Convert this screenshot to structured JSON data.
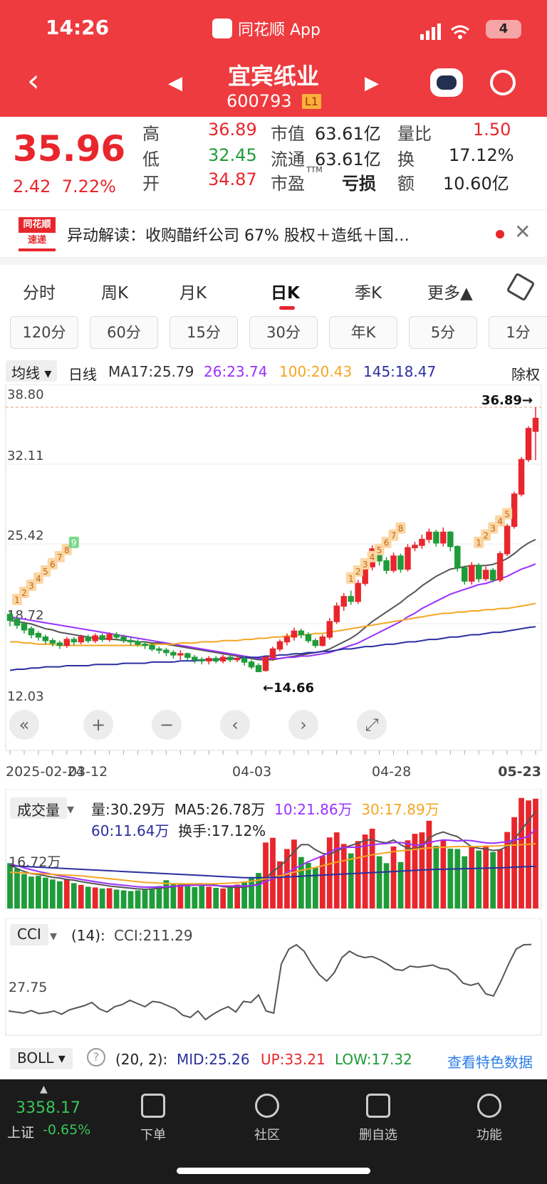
{
  "status": {
    "time": "14:26",
    "app": "同花顺 App",
    "battery": "4"
  },
  "header": {
    "name": "宜宾纸业",
    "code": "600793",
    "level": "L1",
    "back_icon": "chevron-left-icon",
    "prev_icon": "triangle-left-icon",
    "next_icon": "triangle-right-icon"
  },
  "quote": {
    "price": "35.96",
    "change": "2.42",
    "change_pct": "7.22%",
    "high_label": "高",
    "high": "36.89",
    "low_label": "低",
    "low": "32.45",
    "open_label": "开",
    "open": "34.87",
    "mcap_label": "市值",
    "mcap": "63.61亿",
    "float_label": "流通",
    "float": "63.61亿",
    "pe_label": "市盈",
    "pe_sup": "TTM",
    "pe": "亏损",
    "volratio_label": "量比",
    "volratio": "1.50",
    "turnover_label": "换",
    "turnover": "17.12%",
    "amount_label": "额",
    "amount": "10.60亿"
  },
  "alert": {
    "logo_top": "同花顺",
    "logo_bottom": "速递",
    "text": "异动解读：收购醋纤公司 67% 股权＋造纸＋国…"
  },
  "tabs": [
    "分时",
    "周K",
    "月K",
    "日K",
    "季K",
    "更多▲"
  ],
  "periods": [
    "120分",
    "60分",
    "15分",
    "30分",
    "年K",
    "5分",
    "1分"
  ],
  "ma": {
    "select": "均线 ▾",
    "type": "日线",
    "ma17": "MA17:25.79",
    "ma26": "26:23.74",
    "ma100": "100:20.43",
    "ma145": "145:18.47",
    "adjust": "除权"
  },
  "colors": {
    "up": "#e8262c",
    "down": "#1f9c3a",
    "ma17": "#555555",
    "ma26": "#9b30ff",
    "ma100": "#f5a623",
    "ma145": "#2a2fa0"
  },
  "chart_data": [
    {
      "type": "candlestick",
      "y_ticks": [
        "38.80",
        "32.11",
        "25.42",
        "18.72",
        "12.03"
      ],
      "ylim": [
        12.03,
        38.8
      ],
      "x_ticks": [
        "2025-02-24",
        "03-12",
        "04-03",
        "04-28",
        "05-23"
      ],
      "high_marker": "36.89→",
      "low_marker": "←14.66",
      "candles": [
        [
          19.5,
          19.0,
          18.5,
          19.8
        ],
        [
          19.1,
          18.6,
          18.3,
          19.3
        ],
        [
          18.7,
          18.2,
          17.9,
          18.9
        ],
        [
          18.3,
          17.8,
          17.5,
          18.5
        ],
        [
          17.9,
          17.6,
          17.3,
          18.1
        ],
        [
          17.6,
          17.3,
          17.0,
          17.8
        ],
        [
          17.3,
          17.1,
          16.8,
          17.5
        ],
        [
          17.1,
          16.9,
          16.6,
          17.3
        ],
        [
          16.9,
          17.4,
          16.7,
          17.6
        ],
        [
          17.4,
          17.2,
          16.9,
          17.6
        ],
        [
          17.2,
          17.6,
          17.0,
          17.8
        ],
        [
          17.6,
          17.3,
          17.1,
          17.8
        ],
        [
          17.3,
          17.7,
          17.1,
          17.9
        ],
        [
          17.7,
          17.4,
          17.2,
          17.9
        ],
        [
          17.4,
          17.8,
          17.2,
          18.0
        ],
        [
          17.8,
          17.6,
          17.3,
          18.0
        ],
        [
          17.6,
          17.3,
          17.1,
          17.8
        ],
        [
          17.3,
          17.2,
          16.9,
          17.6
        ],
        [
          17.2,
          17.0,
          16.8,
          17.4
        ],
        [
          17.0,
          16.9,
          16.6,
          17.2
        ],
        [
          16.9,
          16.6,
          16.4,
          17.1
        ],
        [
          16.6,
          16.5,
          16.2,
          16.8
        ],
        [
          16.5,
          16.3,
          16.0,
          16.7
        ],
        [
          16.3,
          16.1,
          15.8,
          16.5
        ],
        [
          16.1,
          16.2,
          15.7,
          16.5
        ],
        [
          16.2,
          15.9,
          15.6,
          16.3
        ],
        [
          15.9,
          15.7,
          15.4,
          16.1
        ],
        [
          15.7,
          15.6,
          15.3,
          15.9
        ],
        [
          15.6,
          15.8,
          15.3,
          16.0
        ],
        [
          15.8,
          15.6,
          15.4,
          16.0
        ],
        [
          15.6,
          15.9,
          15.4,
          16.1
        ],
        [
          15.9,
          15.7,
          15.5,
          16.1
        ],
        [
          15.7,
          15.8,
          15.5,
          16.0
        ],
        [
          15.8,
          15.5,
          15.2,
          16.0
        ],
        [
          15.5,
          15.1,
          14.9,
          15.7
        ],
        [
          15.2,
          14.7,
          14.66,
          15.4
        ],
        [
          14.8,
          15.9,
          14.7,
          16.0
        ],
        [
          15.9,
          16.6,
          15.6,
          16.8
        ],
        [
          16.6,
          17.2,
          16.4,
          17.4
        ],
        [
          17.2,
          17.6,
          16.9,
          17.9
        ],
        [
          17.6,
          18.1,
          17.3,
          18.4
        ],
        [
          18.1,
          17.8,
          17.5,
          18.3
        ],
        [
          17.8,
          17.3,
          17.1,
          18.0
        ],
        [
          17.3,
          16.9,
          16.7,
          17.5
        ],
        [
          16.9,
          17.6,
          16.8,
          17.8
        ],
        [
          17.6,
          18.9,
          17.4,
          19.2
        ],
        [
          18.9,
          20.2,
          18.7,
          20.5
        ],
        [
          20.2,
          21.0,
          19.8,
          21.3
        ],
        [
          21.0,
          20.6,
          20.3,
          21.5
        ],
        [
          20.6,
          22.1,
          20.4,
          22.4
        ],
        [
          22.1,
          23.5,
          21.9,
          23.8
        ],
        [
          23.5,
          25.0,
          23.2,
          25.3
        ],
        [
          25.0,
          24.0,
          23.6,
          25.4
        ],
        [
          24.0,
          23.2,
          22.9,
          24.3
        ],
        [
          23.2,
          24.4,
          23.0,
          24.7
        ],
        [
          24.4,
          23.3,
          23.0,
          24.6
        ],
        [
          23.3,
          25.1,
          23.1,
          25.4
        ],
        [
          25.1,
          25.3,
          24.8,
          25.6
        ],
        [
          25.3,
          25.8,
          25.0,
          26.2
        ],
        [
          25.8,
          26.4,
          25.5,
          26.7
        ],
        [
          26.4,
          25.5,
          25.2,
          26.6
        ],
        [
          25.5,
          26.4,
          25.2,
          26.8
        ],
        [
          26.4,
          25.2,
          24.8,
          26.5
        ],
        [
          25.2,
          23.4,
          23.1,
          25.3
        ],
        [
          23.4,
          22.3,
          22.0,
          23.6
        ],
        [
          22.3,
          23.6,
          22.0,
          23.9
        ],
        [
          23.6,
          22.5,
          22.2,
          23.8
        ],
        [
          22.5,
          23.2,
          22.3,
          23.5
        ],
        [
          23.2,
          22.4,
          22.2,
          23.4
        ],
        [
          22.4,
          24.6,
          22.2,
          24.8
        ],
        [
          24.6,
          26.9,
          24.4,
          27.1
        ],
        [
          26.9,
          29.6,
          26.7,
          29.8
        ],
        [
          29.6,
          32.5,
          29.4,
          32.7
        ],
        [
          32.5,
          35.1,
          32.3,
          35.3
        ],
        [
          34.87,
          35.96,
          32.45,
          36.89
        ]
      ],
      "ma17": [
        19.0,
        18.9,
        18.8,
        18.7,
        18.5,
        18.3,
        18.2,
        18.0,
        17.9,
        17.8,
        17.7,
        17.6,
        17.5,
        17.5,
        17.4,
        17.4,
        17.3,
        17.3,
        17.2,
        17.2,
        17.1,
        17.1,
        17.0,
        16.9,
        16.8,
        16.7,
        16.6,
        16.5,
        16.4,
        16.3,
        16.2,
        16.1,
        16.0,
        15.9,
        15.8,
        15.7,
        15.7,
        15.7,
        15.8,
        15.9,
        16.0,
        16.1,
        16.2,
        16.3,
        16.4,
        16.6,
        16.9,
        17.2,
        17.5,
        17.9,
        18.4,
        18.9,
        19.3,
        19.7,
        20.1,
        20.5,
        21.0,
        21.4,
        21.9,
        22.3,
        22.7,
        23.0,
        23.3,
        23.4,
        23.5,
        23.6,
        23.6,
        23.6,
        23.7,
        23.9,
        24.2,
        24.6,
        25.1,
        25.5,
        25.79
      ],
      "ma26": [
        19.3,
        19.2,
        19.1,
        19.0,
        18.9,
        18.8,
        18.7,
        18.6,
        18.5,
        18.4,
        18.3,
        18.2,
        18.1,
        18.0,
        17.9,
        17.8,
        17.7,
        17.6,
        17.5,
        17.4,
        17.3,
        17.2,
        17.1,
        17.0,
        16.9,
        16.8,
        16.7,
        16.6,
        16.5,
        16.4,
        16.3,
        16.2,
        16.1,
        16.0,
        15.9,
        15.8,
        15.8,
        15.8,
        15.8,
        15.9,
        15.9,
        16.0,
        16.0,
        16.1,
        16.2,
        16.3,
        16.5,
        16.7,
        16.9,
        17.1,
        17.4,
        17.7,
        18.0,
        18.3,
        18.6,
        18.9,
        19.3,
        19.6,
        20.0,
        20.3,
        20.6,
        20.9,
        21.2,
        21.4,
        21.6,
        21.8,
        22.0,
        22.1,
        22.3,
        22.5,
        22.7,
        23.0,
        23.3,
        23.5,
        23.74
      ],
      "ma100": [
        17.2,
        17.2,
        17.1,
        17.1,
        17.0,
        17.0,
        17.0,
        16.9,
        16.9,
        16.9,
        16.9,
        16.9,
        16.9,
        16.9,
        16.9,
        16.9,
        16.9,
        16.9,
        16.9,
        16.9,
        17.0,
        17.0,
        17.0,
        17.0,
        17.1,
        17.1,
        17.1,
        17.2,
        17.2,
        17.2,
        17.3,
        17.3,
        17.3,
        17.4,
        17.4,
        17.5,
        17.5,
        17.6,
        17.6,
        17.7,
        17.7,
        17.8,
        17.8,
        17.9,
        17.9,
        18.0,
        18.1,
        18.2,
        18.3,
        18.4,
        18.5,
        18.6,
        18.7,
        18.8,
        18.9,
        19.0,
        19.1,
        19.2,
        19.3,
        19.4,
        19.5,
        19.6,
        19.6,
        19.7,
        19.7,
        19.8,
        19.8,
        19.9,
        19.9,
        20.0,
        20.0,
        20.1,
        20.2,
        20.3,
        20.43
      ],
      "ma145": [
        14.8,
        14.9,
        14.9,
        15.0,
        15.0,
        15.1,
        15.1,
        15.1,
        15.2,
        15.2,
        15.2,
        15.2,
        15.3,
        15.3,
        15.3,
        15.3,
        15.4,
        15.4,
        15.4,
        15.4,
        15.5,
        15.5,
        15.5,
        15.5,
        15.6,
        15.6,
        15.6,
        15.7,
        15.7,
        15.7,
        15.8,
        15.8,
        15.8,
        15.9,
        15.9,
        15.9,
        16.0,
        16.0,
        16.1,
        16.1,
        16.2,
        16.2,
        16.3,
        16.3,
        16.4,
        16.4,
        16.5,
        16.6,
        16.6,
        16.7,
        16.8,
        16.8,
        16.9,
        17.0,
        17.0,
        17.1,
        17.2,
        17.2,
        17.3,
        17.4,
        17.4,
        17.5,
        17.6,
        17.6,
        17.7,
        17.8,
        17.8,
        17.9,
        18.0,
        18.0,
        18.1,
        18.2,
        18.3,
        18.4,
        18.47
      ]
    },
    {
      "type": "bar",
      "title": "成交量",
      "label_vol": "量:30.29万",
      "label_ma5": "MA5:26.78万",
      "label_ma10": "10:21.86万",
      "label_ma30": "30:17.89万",
      "label_ma60": "60:11.64万",
      "label_turnover": "换手:17.12%",
      "y_tick": "16.72万",
      "ylim": [
        0,
        33
      ],
      "values": [
        12.5,
        11.0,
        9.5,
        8.8,
        9.0,
        8.5,
        8.0,
        7.5,
        8.2,
        7.0,
        6.5,
        6.0,
        5.8,
        5.5,
        5.6,
        5.2,
        5.0,
        4.8,
        5.0,
        5.1,
        5.6,
        6.2,
        7.8,
        7.0,
        6.6,
        6.3,
        5.9,
        6.2,
        6.0,
        5.7,
        5.5,
        5.8,
        6.6,
        7.4,
        8.6,
        9.8,
        18.2,
        19.5,
        13.0,
        16.4,
        19.0,
        14.2,
        12.6,
        11.2,
        14.5,
        19.6,
        21.0,
        17.8,
        15.2,
        18.6,
        20.4,
        22.0,
        14.4,
        12.5,
        17.1,
        12.8,
        18.8,
        20.6,
        21.0,
        24.2,
        17.3,
        18.9,
        16.5,
        16.4,
        14.4,
        17.0,
        16.0,
        17.0,
        15.6,
        16.2,
        21.1,
        25.2,
        30.5,
        29.8,
        30.29
      ],
      "ma5": [
        12.0,
        11.0,
        10.2,
        9.6,
        9.4,
        9.0,
        8.6,
        8.4,
        8.0,
        7.8,
        7.4,
        7.1,
        6.8,
        6.5,
        6.2,
        6.0,
        5.8,
        5.6,
        5.4,
        5.3,
        5.4,
        5.6,
        5.8,
        6.0,
        6.4,
        6.6,
        6.8,
        6.8,
        6.6,
        6.4,
        6.0,
        5.9,
        5.8,
        5.9,
        6.2,
        6.8,
        8.3,
        10.2,
        11.6,
        13.5,
        15.7,
        17.6,
        17.6,
        16.2,
        15.2,
        14.9,
        15.9,
        16.7,
        17.4,
        18.0,
        18.8,
        19.0,
        18.4,
        18.1,
        18.9,
        17.6,
        16.6,
        16.4,
        17.3,
        19.4,
        20.5,
        21.1,
        20.4,
        19.8,
        18.4,
        17.0,
        16.6,
        16.4,
        16.0,
        16.2,
        17.1,
        19.0,
        21.7,
        24.2,
        26.78
      ],
      "ma10": [
        12.2,
        11.8,
        11.2,
        10.7,
        10.2,
        9.8,
        9.4,
        9.0,
        8.7,
        8.4,
        8.0,
        7.7,
        7.4,
        7.1,
        6.8,
        6.6,
        6.4,
        6.2,
        6.0,
        5.9,
        5.9,
        5.9,
        6.0,
        6.1,
        6.2,
        6.3,
        6.4,
        6.4,
        6.4,
        6.3,
        6.2,
        6.2,
        6.2,
        6.2,
        6.3,
        6.5,
        7.4,
        8.2,
        8.9,
        9.9,
        10.9,
        11.9,
        12.9,
        13.7,
        14.5,
        15.6,
        16.5,
        16.8,
        16.9,
        16.9,
        17.3,
        17.5,
        17.8,
        17.9,
        18.2,
        18.2,
        17.9,
        17.4,
        17.6,
        18.2,
        18.6,
        18.9,
        18.8,
        18.6,
        18.8,
        18.7,
        18.4,
        18.1,
        18.0,
        18.2,
        18.4,
        18.9,
        19.3,
        19.9,
        21.86
      ],
      "ma30": [
        10.0,
        9.9,
        9.8,
        9.7,
        9.6,
        9.5,
        9.4,
        9.3,
        9.2,
        9.1,
        9.0,
        8.8,
        8.6,
        8.4,
        8.2,
        8.0,
        7.8,
        7.6,
        7.4,
        7.2,
        7.1,
        7.0,
        6.9,
        6.8,
        6.8,
        6.8,
        6.8,
        6.8,
        6.8,
        6.8,
        6.9,
        7.0,
        7.1,
        7.3,
        7.5,
        7.8,
        8.2,
        8.6,
        9.0,
        9.5,
        10.0,
        10.5,
        10.9,
        11.3,
        11.8,
        12.3,
        12.8,
        13.2,
        13.6,
        14.0,
        14.4,
        14.8,
        15.1,
        15.4,
        15.7,
        15.9,
        16.1,
        16.3,
        16.5,
        16.7,
        16.8,
        16.9,
        17.0,
        17.1,
        17.1,
        17.1,
        17.1,
        17.2,
        17.2,
        17.3,
        17.4,
        17.5,
        17.6,
        17.7,
        17.89
      ],
      "ma60": [
        11.8,
        11.7,
        11.6,
        11.5,
        11.4,
        11.3,
        11.2,
        11.1,
        11.0,
        10.9,
        10.8,
        10.7,
        10.6,
        10.5,
        10.4,
        10.3,
        10.2,
        10.1,
        10.0,
        9.9,
        9.8,
        9.7,
        9.6,
        9.5,
        9.4,
        9.3,
        9.2,
        9.1,
        9.0,
        8.9,
        8.8,
        8.7,
        8.6,
        8.5,
        8.5,
        8.5,
        8.5,
        8.6,
        8.6,
        8.7,
        8.8,
        8.9,
        9.0,
        9.1,
        9.2,
        9.3,
        9.4,
        9.5,
        9.6,
        9.7,
        9.8,
        9.9,
        10.0,
        10.1,
        10.2,
        10.3,
        10.4,
        10.5,
        10.6,
        10.7,
        10.8,
        10.8,
        10.9,
        10.9,
        11.0,
        11.0,
        11.1,
        11.1,
        11.2,
        11.2,
        11.3,
        11.4,
        11.5,
        11.55,
        11.64
      ]
    },
    {
      "type": "line",
      "title": "CCI",
      "params": "(14):",
      "label": "CCI:211.29",
      "y_tick": "27.75",
      "ylim": [
        -200,
        300
      ],
      "values": [
        -100,
        -105,
        -110,
        -98,
        -112,
        -108,
        -100,
        -115,
        -95,
        -85,
        -75,
        -60,
        -90,
        -105,
        -80,
        -70,
        -50,
        -65,
        -80,
        -55,
        -60,
        -75,
        -90,
        -120,
        -130,
        -100,
        -140,
        -115,
        -95,
        -80,
        -105,
        -55,
        -60,
        -25,
        -100,
        -110,
        120,
        190,
        210,
        180,
        120,
        70,
        40,
        80,
        150,
        180,
        160,
        150,
        155,
        140,
        120,
        95,
        90,
        110,
        105,
        110,
        115,
        100,
        95,
        70,
        30,
        20,
        30,
        -20,
        -30,
        40,
        120,
        190,
        210,
        211.29
      ]
    }
  ],
  "chart_overlay": {
    "controls": [
      "«",
      "+",
      "−",
      "‹",
      "›",
      "⤢"
    ],
    "buy_signals": [
      "1",
      "2",
      "3",
      "4",
      "5",
      "6",
      "7",
      "8",
      "9"
    ]
  },
  "boll": {
    "select": "BOLL ▾",
    "help_icon": "question-circle-icon",
    "params": "(20, 2):",
    "mid": "MID:25.26",
    "up": "UP:33.21",
    "low": "LOW:17.32",
    "link": "查看特色数据"
  },
  "tabbar": {
    "index_value": "3358.17",
    "index_name": "上证",
    "index_change": "-0.65%",
    "items": [
      {
        "label": "下单",
        "icon": "order-icon"
      },
      {
        "label": "社区",
        "icon": "community-star-icon"
      },
      {
        "label": "删自选",
        "icon": "remove-watchlist-icon"
      },
      {
        "label": "功能",
        "icon": "menu-icon"
      }
    ]
  }
}
